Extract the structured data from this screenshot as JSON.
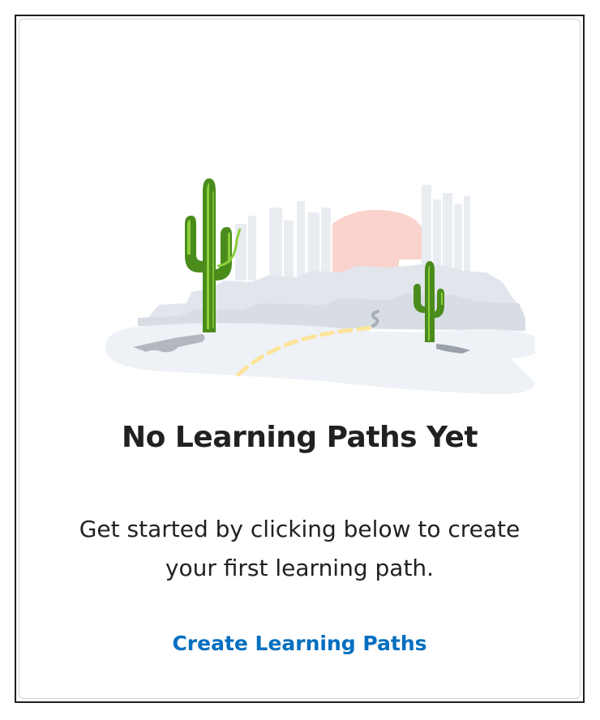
{
  "empty_state": {
    "title": "No Learning Paths Yet",
    "description": "Get started by clicking below to create your first learning path.",
    "action_label": "Create Learning Paths",
    "illustration_icon": "desert-cactus-illustration"
  },
  "colors": {
    "title_text": "#202122",
    "link": "#006fbf",
    "cactus_green": "#4a8c1c",
    "cactus_light": "#8ccf3a",
    "sun": "#f9d3cc",
    "skyline": "#e6eaf0",
    "ground": "#eef1f5",
    "path_dashes": "#fde49a"
  }
}
